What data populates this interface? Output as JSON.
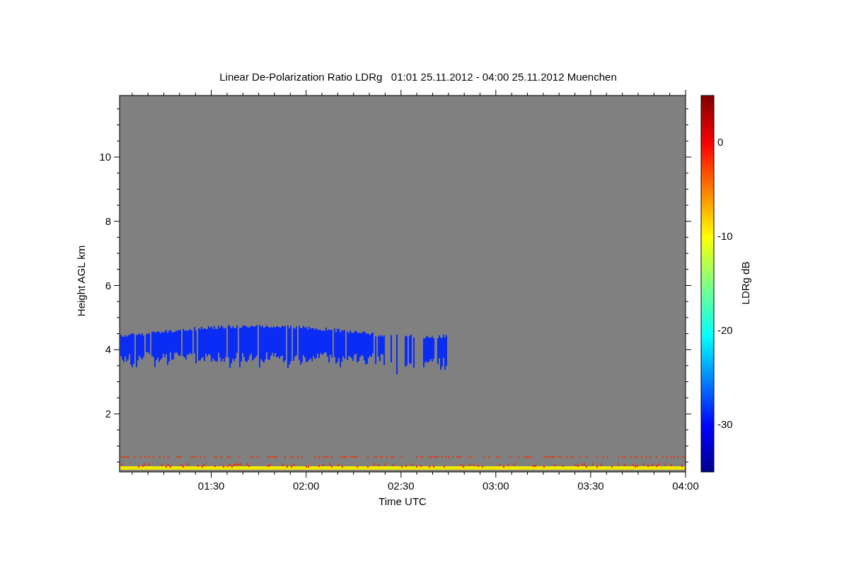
{
  "plot": {
    "title": "Linear De-Polarization Ratio LDRg   01:01 25.11.2012 - 04:00 25.11.2012 Muenchen",
    "xlabel": "Time UTC",
    "ylabel": "Height AGL km",
    "xtick_labels": [
      "01:30",
      "02:00",
      "02:30",
      "03:00",
      "03:30",
      "04:00"
    ],
    "ytick_labels": [
      "10",
      "8",
      "6",
      "4",
      "2"
    ]
  },
  "colorbar": {
    "label": "LDRg dB",
    "tick_labels": [
      "0",
      "-10",
      "-20",
      "-30"
    ]
  }
}
